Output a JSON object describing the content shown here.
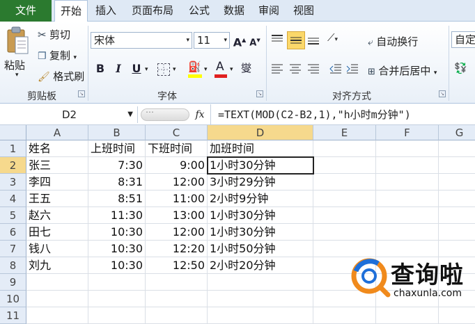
{
  "tabs": {
    "file": "文件",
    "home": "开始",
    "insert": "插入",
    "layout": "页面布局",
    "formula": "公式",
    "data": "数据",
    "review": "审阅",
    "view": "视图"
  },
  "clipboard": {
    "paste": "粘贴",
    "cut": "剪切",
    "copy": "复制",
    "painter": "格式刷",
    "group": "剪贴板"
  },
  "font": {
    "name": "宋体",
    "size": "11",
    "group": "字体",
    "bold": "B",
    "italic": "I",
    "underline": "U",
    "grow": "A",
    "shrink": "A",
    "color_letter": "A",
    "phonetic": "燮"
  },
  "alignment": {
    "wrap": "自动换行",
    "merge": "合并后居中",
    "group": "对齐方式",
    "num_format_partial": "自定"
  },
  "formula_bar": {
    "name_box": "D2",
    "fx": "fx",
    "formula": "=TEXT(MOD(C2-B2,1),\"h小时m分钟\")"
  },
  "columns": [
    "A",
    "B",
    "C",
    "D",
    "E",
    "F",
    "G"
  ],
  "rows": [
    {
      "n": "1",
      "a": "姓名",
      "b": "上班时间",
      "c": "下班时间",
      "d": "加班时间"
    },
    {
      "n": "2",
      "a": "张三",
      "b": "7:30",
      "c": "9:00",
      "d": "1小时30分钟"
    },
    {
      "n": "3",
      "a": "李四",
      "b": "8:31",
      "c": "12:00",
      "d": "3小时29分钟"
    },
    {
      "n": "4",
      "a": "王五",
      "b": "8:51",
      "c": "11:00",
      "d": "2小时9分钟"
    },
    {
      "n": "5",
      "a": "赵六",
      "b": "11:30",
      "c": "13:00",
      "d": "1小时30分钟"
    },
    {
      "n": "6",
      "a": "田七",
      "b": "10:30",
      "c": "12:00",
      "d": "1小时30分钟"
    },
    {
      "n": "7",
      "a": "钱八",
      "b": "10:30",
      "c": "12:20",
      "d": "1小时50分钟"
    },
    {
      "n": "8",
      "a": "刘九",
      "b": "10:30",
      "c": "12:50",
      "d": "2小时20分钟"
    },
    {
      "n": "9",
      "a": "",
      "b": "",
      "c": "",
      "d": ""
    },
    {
      "n": "10",
      "a": "",
      "b": "",
      "c": "",
      "d": ""
    },
    {
      "n": "11",
      "a": "",
      "b": "",
      "c": "",
      "d": ""
    }
  ],
  "watermark": {
    "title": "查询啦",
    "url": "chaxunla.com"
  },
  "colors": {
    "file_tab": "#2b7a2f",
    "highlight": "#ffff00",
    "font_color": "#e02020",
    "watermark_orange": "#f08a1c",
    "watermark_blue": "#1e6fd9"
  }
}
